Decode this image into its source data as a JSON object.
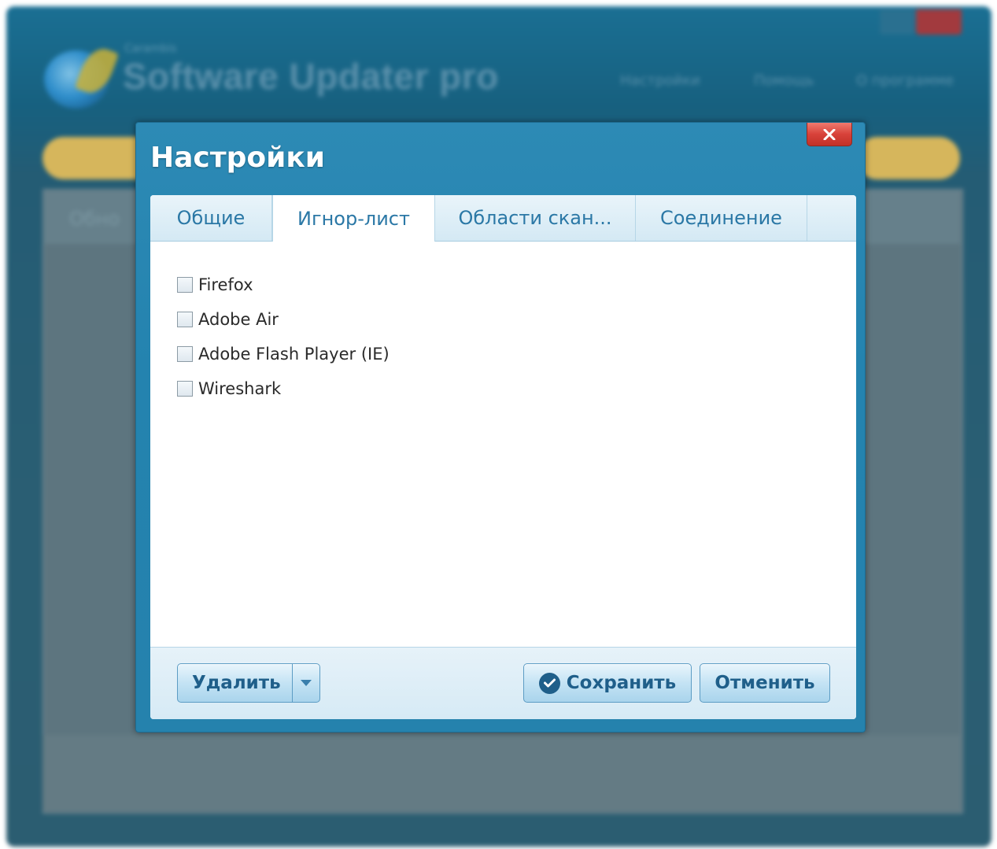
{
  "background_window": {
    "brand_small": "Carambis",
    "app_title": "Software Updater pro",
    "menu": [
      "Настройки",
      "Помощь",
      "О программе"
    ],
    "panel_header": "Обно"
  },
  "dialog": {
    "title": "Настройки",
    "close_icon": "close-icon",
    "tabs": [
      {
        "label": "Общие",
        "active": false
      },
      {
        "label": "Игнор-лист",
        "active": true
      },
      {
        "label": "Области скан...",
        "active": false
      },
      {
        "label": "Соединение",
        "active": false
      }
    ],
    "ignore_list": [
      {
        "label": "Firefox",
        "checked": false
      },
      {
        "label": "Adobe Air",
        "checked": false
      },
      {
        "label": "Adobe Flash Player (IE)",
        "checked": false
      },
      {
        "label": "Wireshark",
        "checked": false
      }
    ],
    "buttons": {
      "delete": "Удалить",
      "save": "Сохранить",
      "cancel": "Отменить"
    }
  },
  "colors": {
    "dialog_blue": "#2483af",
    "tab_text": "#2b78a6",
    "button_text": "#1f5f8a",
    "close_red": "#d8423a"
  }
}
